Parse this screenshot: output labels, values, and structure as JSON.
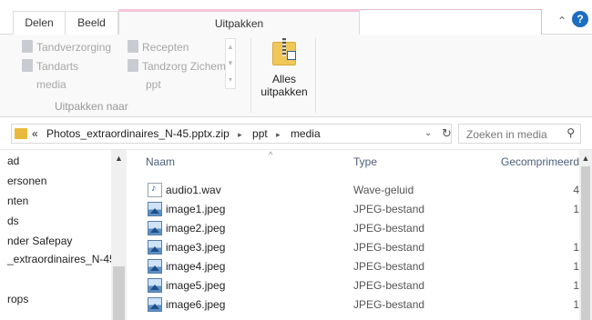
{
  "ribbon": {
    "tabs": {
      "delen": "Delen",
      "beeld": "Beeld",
      "uitpakken": "Uitpakken"
    },
    "gallery": {
      "col1": [
        "Tandverzorging",
        "Tandarts",
        "media"
      ],
      "col2": [
        "Recepten",
        "Tandzorg Zichem",
        "ppt"
      ],
      "label": "Uitpakken naar"
    },
    "extract_all": {
      "line1": "Alles",
      "line2": "uitpakken"
    },
    "collapse_icon": "chevron-up-icon",
    "help_icon": "?"
  },
  "address": {
    "overflow": "«",
    "crumbs": [
      "Photos_extraordinaires_N-45.pptx.zip",
      "ppt",
      "media"
    ],
    "search_placeholder": "Zoeken in media"
  },
  "nav": {
    "items": [
      "ad",
      "ersonen",
      "nten",
      "ds",
      "nder Safepay",
      "_extraordinaires_N-45",
      "",
      "rops"
    ]
  },
  "columns": {
    "name": "Naam",
    "type": "Type",
    "compressed": "Gecomprimeerd"
  },
  "files": [
    {
      "name": "audio1.wav",
      "type": "Wave-geluid",
      "size": "4",
      "icon": "audio-file-icon"
    },
    {
      "name": "image1.jpeg",
      "type": "JPEG-bestand",
      "size": "1",
      "icon": "image-file-icon"
    },
    {
      "name": "image2.jpeg",
      "type": "JPEG-bestand",
      "size": "",
      "icon": "image-file-icon"
    },
    {
      "name": "image3.jpeg",
      "type": "JPEG-bestand",
      "size": "1",
      "icon": "image-file-icon"
    },
    {
      "name": "image4.jpeg",
      "type": "JPEG-bestand",
      "size": "1",
      "icon": "image-file-icon"
    },
    {
      "name": "image5.jpeg",
      "type": "JPEG-bestand",
      "size": "1",
      "icon": "image-file-icon"
    },
    {
      "name": "image6.jpeg",
      "type": "JPEG-bestand",
      "size": "1",
      "icon": "image-file-icon"
    }
  ]
}
